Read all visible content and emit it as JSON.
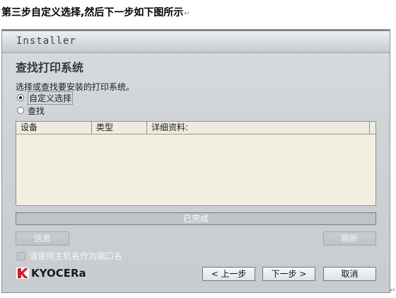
{
  "caption": {
    "text": "第三步自定义选择,然后下一步如下图所示",
    "mark": "↵"
  },
  "window": {
    "title": "Installer",
    "heading": "查找打印系统",
    "description": "选择或查找要安装的打印系统。",
    "radios": [
      {
        "label": "自定义选择",
        "selected": true
      },
      {
        "label": "查找",
        "selected": false
      }
    ],
    "table": {
      "columns": [
        "设备",
        "类型",
        "详细资料:"
      ]
    },
    "progress": {
      "text": "已完成"
    },
    "info_button": "信息",
    "refresh_button": "刷新",
    "checkbox": {
      "label": "请使用主机名作为端口名",
      "checked": false
    },
    "logo_text": "KYOCERa",
    "back_button": "< 上一步",
    "next_button": "下一步 >",
    "cancel_button": "取消"
  },
  "trailing_mark": "↵",
  "colors": {
    "window_bg": "#cfd3d6",
    "table_bg": "#f1efdf",
    "heading": "#2d3a44",
    "logo_red": "#d0202a"
  }
}
